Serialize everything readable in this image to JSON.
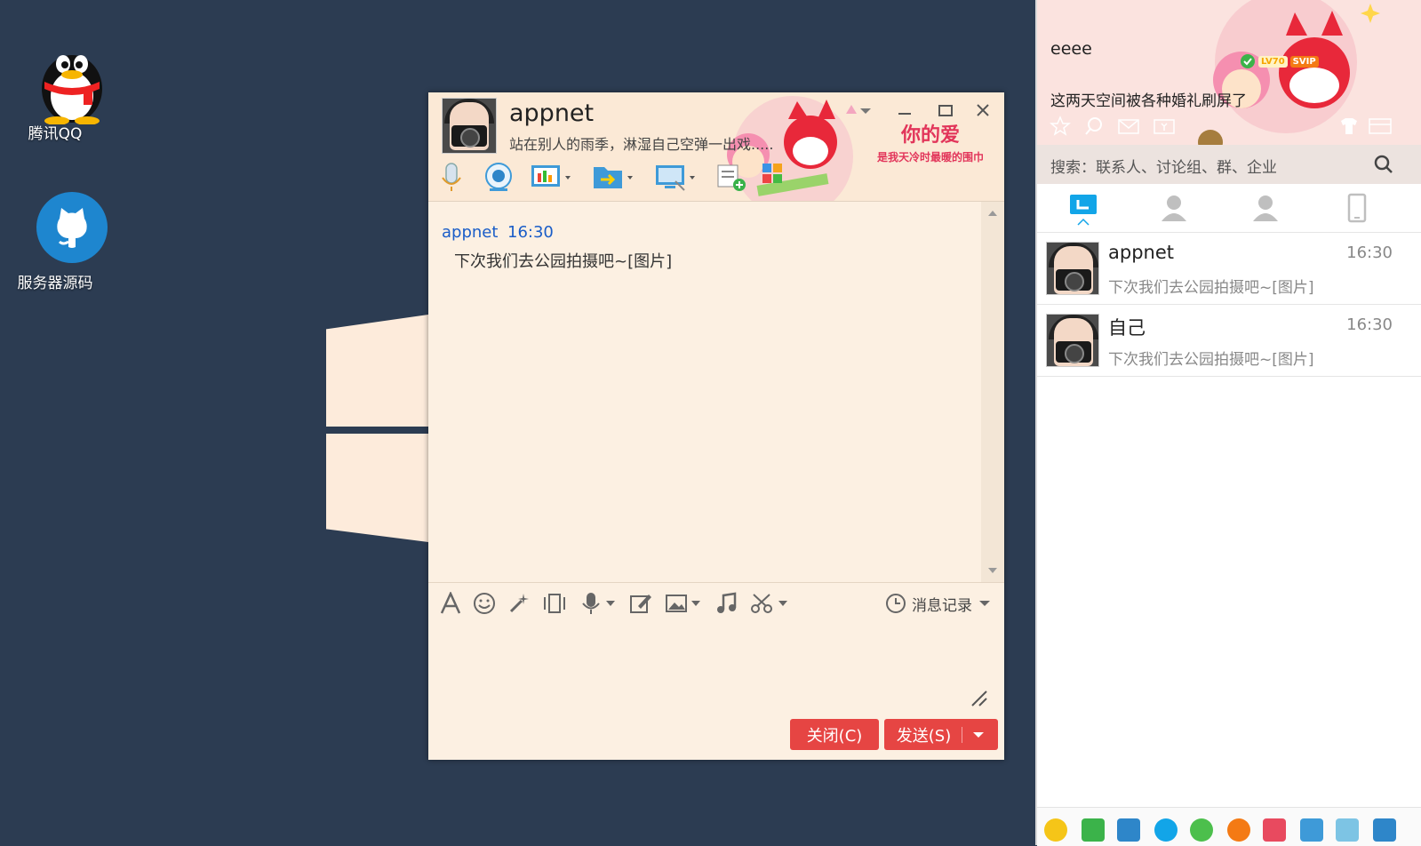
{
  "desktop": {
    "icons": [
      {
        "label": "腾讯QQ",
        "icon": "qq-penguin-icon"
      },
      {
        "label": "服务器源码",
        "icon": "github-octocat-icon"
      }
    ]
  },
  "chat_window": {
    "contact_name": "appnet",
    "contact_status": "站在别人的雨季，淋湿自己空弹一出戏.....",
    "banner_title": "你的爱",
    "banner_subtitle": "是我天冷时最暖的围巾",
    "messages": [
      {
        "sender": "appnet",
        "time": "16:30",
        "text": "下次我们去公园拍摄吧~[图片]"
      }
    ],
    "history_label": "消息记录",
    "close_button": "关闭(C)",
    "send_button": "发送(S)",
    "toolbar_icons": [
      "voice-call-icon",
      "video-call-icon",
      "remote-app-icon",
      "file-transfer-icon",
      "screen-share-icon",
      "create-group-icon"
    ],
    "input_toolbar_icons": [
      "font-icon",
      "emoji-icon",
      "magic-icon",
      "shake-icon",
      "voice-message-icon",
      "edit-icon",
      "image-icon",
      "music-icon",
      "screenshot-icon"
    ]
  },
  "qq_panel": {
    "nickname": "eeee",
    "signature": "这两天空间被各种婚礼刷屏了",
    "level_badge": "LV70",
    "vip_badge": "SVIP",
    "search_placeholder": "搜索：联系人、讨论组、群、企业",
    "tabs": [
      "messages-tab",
      "contacts-tab",
      "groups-tab",
      "devices-tab"
    ],
    "contacts": [
      {
        "name": "appnet",
        "time": "16:30",
        "message": "下次我们去公园拍摄吧~[图片]"
      },
      {
        "name": "自己",
        "time": "16:30",
        "message": "下次我们去公园拍摄吧~[图片]"
      }
    ]
  },
  "colors": {
    "desktop_bg": "#2c3c52",
    "chat_bg": "#fcf0e2",
    "accent_red": "#e64543",
    "link_blue": "#1a5dc8",
    "qq_blue": "#12a5e8"
  }
}
